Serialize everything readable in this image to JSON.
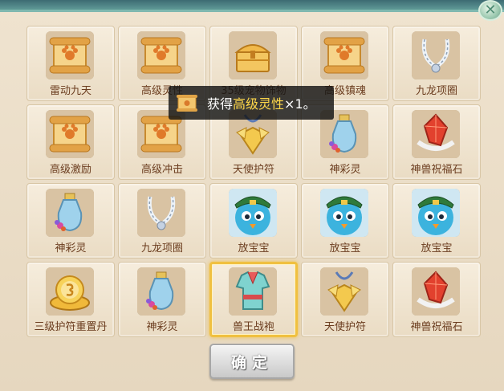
{
  "close_icon": "close-x-icon",
  "items": [
    {
      "label": "雷动九天",
      "icon": "scroll"
    },
    {
      "label": "高级灵性",
      "icon": "scroll"
    },
    {
      "label": "35级宠物饰物",
      "icon": "chest"
    },
    {
      "label": "高级镇魂",
      "icon": "scroll"
    },
    {
      "label": "九龙项圈",
      "icon": "necklace"
    },
    {
      "label": "高级激励",
      "icon": "scroll"
    },
    {
      "label": "高级冲击",
      "icon": "scroll"
    },
    {
      "label": "天使护符",
      "icon": "amulet"
    },
    {
      "label": "神彩灵",
      "icon": "vase"
    },
    {
      "label": "神兽祝福石",
      "icon": "crystal"
    },
    {
      "label": "神彩灵",
      "icon": "vase"
    },
    {
      "label": "九龙项圈",
      "icon": "necklace"
    },
    {
      "label": "放宝宝",
      "icon": "bird"
    },
    {
      "label": "放宝宝",
      "icon": "bird"
    },
    {
      "label": "放宝宝",
      "icon": "bird"
    },
    {
      "label": "三级护符重置丹",
      "icon": "pill"
    },
    {
      "label": "神彩灵",
      "icon": "vase"
    },
    {
      "label": "兽王战袍",
      "icon": "armor",
      "selected": true
    },
    {
      "label": "天使护符",
      "icon": "amulet"
    },
    {
      "label": "神兽祝福石",
      "icon": "crystal"
    }
  ],
  "toast": {
    "prefix": "获得",
    "item": "高级灵性",
    "suffix": "×1。",
    "icon": "scroll"
  },
  "confirm_label": "确定",
  "colors": {
    "panel_bg": "#efe3cf",
    "cell_label": "#6b3d1f",
    "highlight": "#ffd84a",
    "selected_border": "#f0c040"
  }
}
